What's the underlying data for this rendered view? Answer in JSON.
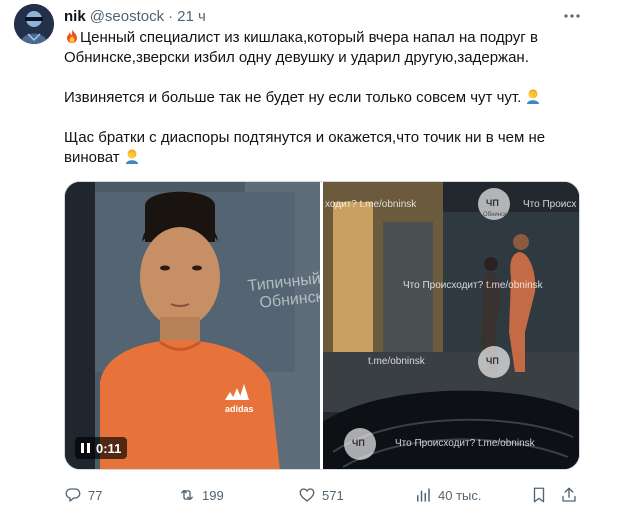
{
  "author": {
    "name": "nik",
    "handle": "@seostock",
    "separator": "·",
    "time": "21 ч"
  },
  "tweet": {
    "line1": "Ценный специалист из кишлака,который вчера напал на подруг в Обнинске,зверски избил одну девушку и ударил другую,задержан.",
    "line2": "Извиняется и больше так не будет ну если только совсем чут чут.",
    "line3": "Щас братки с диаспоры подтянутся и окажется,что точик ни в чем не виноват"
  },
  "media": {
    "left_watermark": "Типичный Обнинск",
    "video_time": "0:11",
    "shirt_logo": "adidas",
    "right_watermarks": {
      "top": "ходит?  t.me/obninsk",
      "top_brand": "Что Происх",
      "mid": "Что Происходит?  t.me/obninsk",
      "low": "t.me/obninsk",
      "bottom": "Что Происходит?  t.me/obninsk",
      "chp": "ЧП",
      "chp_sub": "Обнинск"
    }
  },
  "actions": {
    "replies": "77",
    "reposts": "199",
    "likes": "571",
    "views": "40 тыс."
  },
  "icons": {
    "fire": "fire-icon",
    "facepalm": "facepalm-icon",
    "more": "more-icon",
    "reply": "reply-icon",
    "repost": "repost-icon",
    "like": "heart-icon",
    "views": "views-icon",
    "bookmark": "bookmark-icon",
    "share": "share-icon"
  },
  "colors": {
    "text": "#0f1419",
    "secondary": "#536471",
    "shirt": "#e8733a"
  }
}
